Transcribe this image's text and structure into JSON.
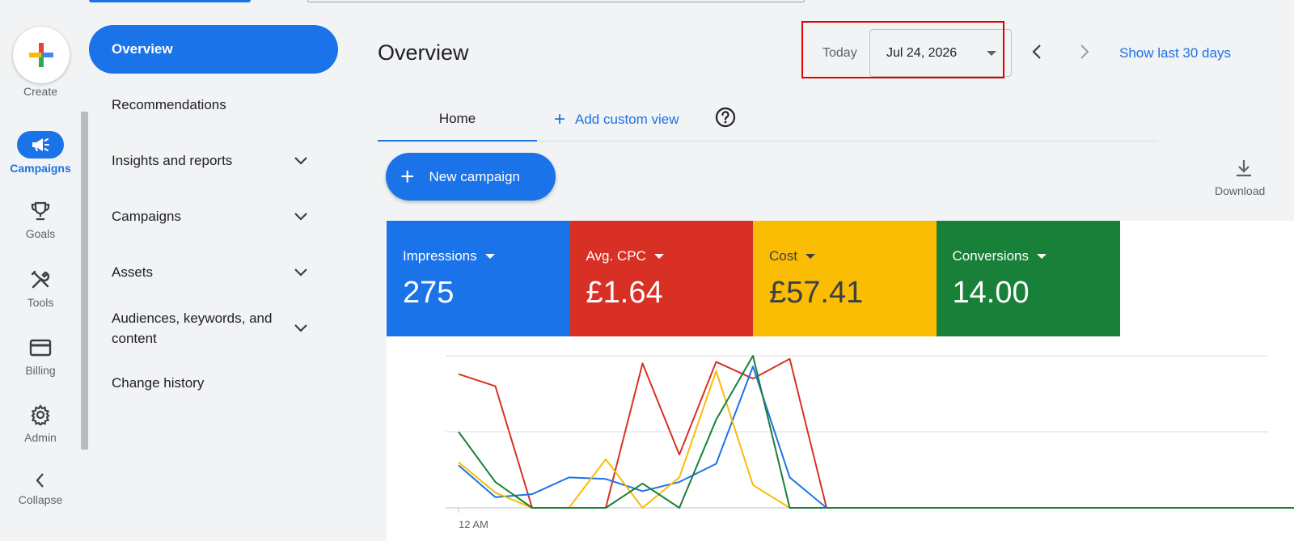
{
  "rail": {
    "create_label": "Create",
    "items": [
      {
        "label": "Campaigns",
        "icon": "megaphone-icon",
        "active": true
      },
      {
        "label": "Goals",
        "icon": "trophy-icon"
      },
      {
        "label": "Tools",
        "icon": "tools-icon"
      },
      {
        "label": "Billing",
        "icon": "credit-card-icon"
      },
      {
        "label": "Admin",
        "icon": "gear-icon"
      },
      {
        "label": "Collapse",
        "icon": "chevron-left-icon"
      }
    ]
  },
  "sidenav": {
    "items": [
      {
        "label": "Overview",
        "active": true
      },
      {
        "label": "Recommendations"
      },
      {
        "label": "Insights and reports",
        "expandable": true
      },
      {
        "label": "Campaigns",
        "expandable": true
      },
      {
        "label": "Assets",
        "expandable": true
      },
      {
        "label": "Audiences, keywords, and content",
        "expandable": true
      },
      {
        "label": "Change history"
      }
    ]
  },
  "header": {
    "title": "Overview",
    "today_label": "Today",
    "date_value": "Jul 24, 2026",
    "show_last": "Show last 30 days"
  },
  "tabs": {
    "home": "Home",
    "add_custom_view": "Add custom view"
  },
  "actions": {
    "new_campaign": "New campaign",
    "download": "Download"
  },
  "metrics": [
    {
      "name": "Impressions",
      "value": "275",
      "color": "#1a73e8",
      "text_color": "#ffffff"
    },
    {
      "name": "Avg. CPC",
      "value": "£1.64",
      "color": "#d93025",
      "text_color": "#ffffff"
    },
    {
      "name": "Cost",
      "value": "£57.41",
      "color": "#fbbc04",
      "text_color": "#3c4043"
    },
    {
      "name": "Conversions",
      "value": "14.00",
      "color": "#188038",
      "text_color": "#ffffff"
    }
  ],
  "chart_data": {
    "type": "line",
    "x_first_label": "12 AM",
    "y_scale": [
      0,
      1
    ],
    "series": [
      {
        "color": "#d93025",
        "values": [
          0.88,
          0.8,
          0,
          0,
          0,
          0.95,
          0.35,
          0.96,
          0.85,
          0.98,
          0,
          0,
          0,
          0,
          0,
          0,
          0,
          0,
          0,
          0,
          0,
          0,
          0,
          0
        ]
      },
      {
        "color": "#1a73e8",
        "values": [
          0.28,
          0.07,
          0.09,
          0.2,
          0.19,
          0.11,
          0.17,
          0.29,
          0.93,
          0.2,
          0,
          0,
          0,
          0,
          0,
          0,
          0,
          0,
          0,
          0,
          0,
          0,
          0,
          0
        ]
      },
      {
        "color": "#fbbc04",
        "values": [
          0.3,
          0.1,
          0,
          0,
          0.32,
          0,
          0.2,
          0.9,
          0.15,
          0,
          0,
          0,
          0,
          0,
          0,
          0,
          0,
          0,
          0,
          0,
          0,
          0,
          0,
          0
        ]
      },
      {
        "color": "#188038",
        "values": [
          0.5,
          0.17,
          0,
          0,
          0,
          0.16,
          0,
          0.58,
          1.0,
          0,
          0,
          0,
          0,
          0,
          0,
          0,
          0,
          0,
          0,
          0,
          0,
          0,
          0,
          0
        ]
      }
    ]
  }
}
